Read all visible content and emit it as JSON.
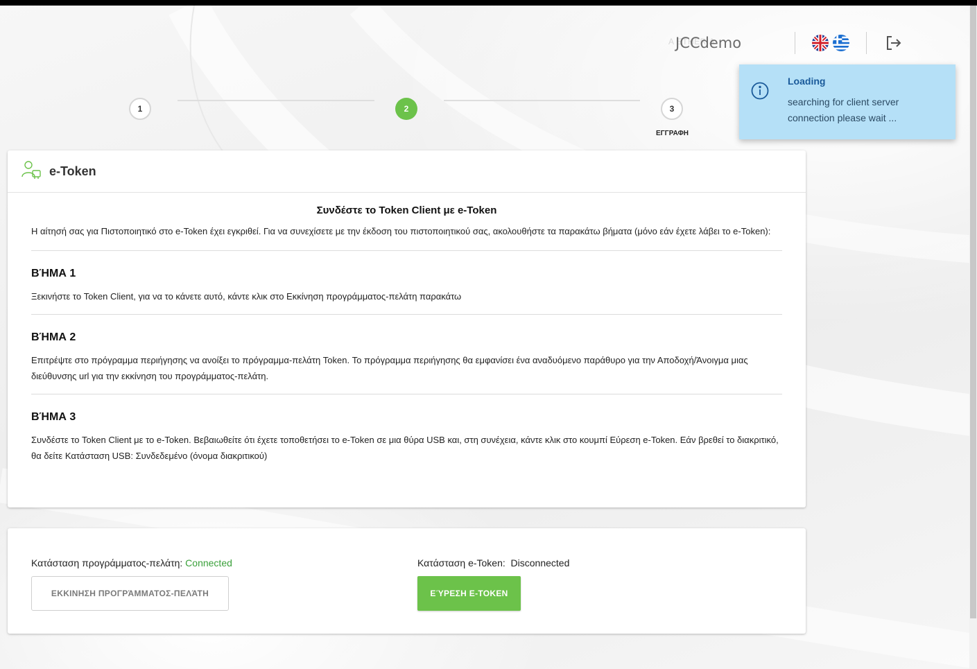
{
  "header": {
    "brand_name": "JCCdemo",
    "brand_faint": "A               ETHERIA",
    "languages": [
      "english-flag-icon",
      "greek-flag-icon"
    ]
  },
  "stepper": {
    "steps": [
      {
        "number": "1",
        "label": "",
        "state": "inactive"
      },
      {
        "number": "2",
        "label": "",
        "state": "active"
      },
      {
        "number": "3",
        "label": "ΕΓΓΡΑΦΗ",
        "state": "inactive"
      }
    ]
  },
  "toast": {
    "title": "Loading",
    "message": "searching for client server connection please wait ...",
    "icon": "info-icon"
  },
  "card": {
    "title": "e-Token",
    "icon": "user-token-icon",
    "main_title": "Συνδέστε το Token Client με e-Token",
    "intro": "Η αίτησή σας για Πιστοποιητικό στο e-Token έχει εγκριθεί. Για να συνεχίσετε με την έκδοση του πιστοποιητικού σας, ακολουθήστε τα παρακάτω βήματα (μόνο εάν έχετε λάβει το e-Token):",
    "steps": [
      {
        "heading": "ΒΉΜΑ 1",
        "text": "Ξεκινήστε το Token Client, για να το κάνετε αυτό, κάντε κλικ στο Εκκίνηση προγράμματος-πελάτη παρακάτω"
      },
      {
        "heading": "ΒΉΜΑ 2",
        "text": "Επιτρέψτε στο πρόγραμμα περιήγησης να ανοίξει το πρόγραμμα-πελάτη Token. Το πρόγραμμα περιήγησης θα εμφανίσει ένα αναδυόμενο παράθυρο για την Αποδοχή/Άνοιγμα μιας διεύθυνσης url για την εκκίνηση του προγράμματος-πελάτη."
      },
      {
        "heading": "ΒΉΜΑ 3",
        "text": "Συνδέστε το Token Client με το e-Token. Βεβαιωθείτε ότι έχετε τοποθετήσει το e-Token σε μια θύρα USB και, στη συνέχεια, κάντε κλικ στο κουμπί Εύρεση e-Token. Εάν βρεθεί το διακριτικό, θα δείτε Κατάσταση USB: Συνδεδεμένο (όνομα διακριτικού)"
      }
    ]
  },
  "status": {
    "client_label": "Κατάσταση προγράμματος-πελάτη:",
    "client_value": "Connected",
    "token_label": "Κατάσταση e-Token:",
    "token_value": "Disconnected",
    "start_button": "ΕΚΚΙΝΗΣΗ ΠΡΟΓΡΆΜΜΑΤΟΣ-ΠΕΛΆΤΗ",
    "find_button": "ΕΎΡΕΣΗ E-TOKEN",
    "accent_color": "#6cc24a"
  }
}
